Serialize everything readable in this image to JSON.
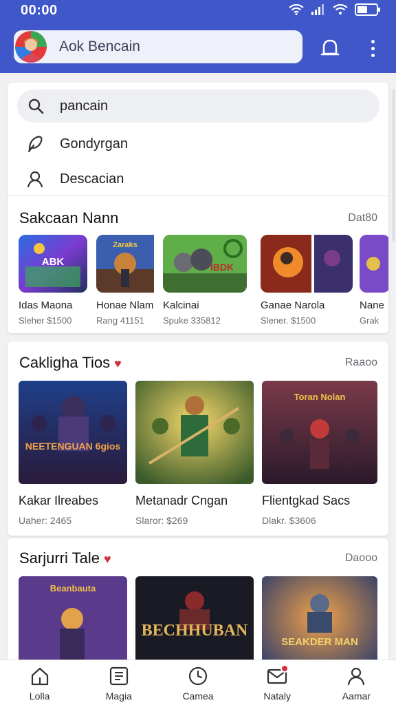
{
  "status": {
    "time": "00:00"
  },
  "header": {
    "search_label": "Aok Bencain",
    "avatar_icon": "avatar-icon",
    "bell_icon": "bell-icon",
    "menu_icon": "more-vert-icon"
  },
  "search": {
    "query": "pancain",
    "suggestions": [
      {
        "label": "Gondyrgan",
        "icon": "leaf-icon"
      },
      {
        "label": "Descacian",
        "icon": "person-icon"
      }
    ]
  },
  "section1": {
    "title": "Sakcaan Nann",
    "link": "Dat80",
    "games": [
      {
        "name": "Idas Maona",
        "price": "Sleher $1500",
        "art": "ABK"
      },
      {
        "name": "Honae Nlam",
        "price": "Rang 41151",
        "art": "Zaraks"
      },
      {
        "name": "Kalcinai",
        "price": "Spuke 335812",
        "art": "IBDK"
      },
      {
        "name": "Ganae Narola",
        "price": "Slener. $1500",
        "art": ""
      },
      {
        "name": "Nane",
        "price": "Grak",
        "art": ""
      }
    ]
  },
  "section2": {
    "title": "Cakligha Tios",
    "link": "Raaoo",
    "games": [
      {
        "name": "Kakar Ilreabes",
        "price": "Uaher: 2465",
        "art": "NEETENGUAN 6gios"
      },
      {
        "name": "Metanadr Cngan",
        "price": "Slaror: $269",
        "art": ""
      },
      {
        "name": "Flientgkad Sacs",
        "price": "Dlakr. $3606",
        "art": "Toran Nolan"
      }
    ]
  },
  "section3": {
    "title": "Sarjurri Tale",
    "link": "Daooo",
    "games": [
      {
        "name": "",
        "price": "",
        "art": "Beanbauta"
      },
      {
        "name": "",
        "price": "",
        "art": "BECHHUBAN"
      },
      {
        "name": "",
        "price": "",
        "art": "SEAKDER MAN"
      }
    ]
  },
  "nav": [
    {
      "label": "Lolla",
      "icon": "home-icon"
    },
    {
      "label": "Magia",
      "icon": "grid-icon"
    },
    {
      "label": "Camea",
      "icon": "clock-icon"
    },
    {
      "label": "Nataly",
      "icon": "mail-icon"
    },
    {
      "label": "Aamar",
      "icon": "person-icon"
    }
  ],
  "colors": {
    "primary": "#3f57c8",
    "accent": "#d0323a"
  }
}
